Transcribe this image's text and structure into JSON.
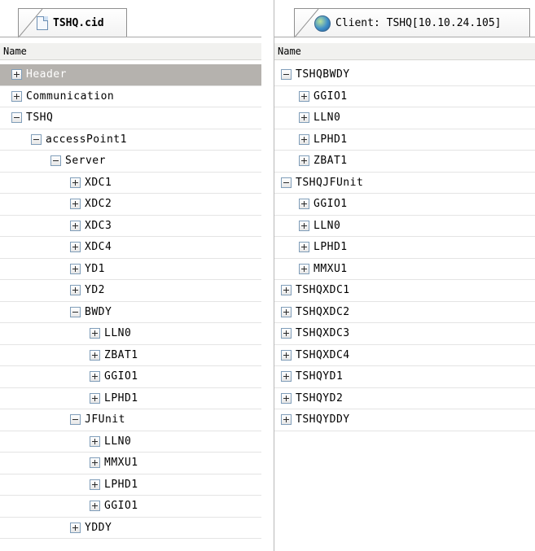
{
  "left_panel": {
    "tab_title": "TSHQ.cid",
    "column_header": "Name",
    "rows": [
      {
        "label": "Header",
        "expander": "plus",
        "level": 0,
        "selected": true
      },
      {
        "label": "Communication",
        "expander": "plus",
        "level": 0
      },
      {
        "label": "TSHQ",
        "expander": "minus",
        "level": 0
      },
      {
        "label": "accessPoint1",
        "expander": "minus",
        "level": 1
      },
      {
        "label": "Server",
        "expander": "minus",
        "level": 2
      },
      {
        "label": "XDC1",
        "expander": "plus",
        "level": 3
      },
      {
        "label": "XDC2",
        "expander": "plus",
        "level": 3
      },
      {
        "label": "XDC3",
        "expander": "plus",
        "level": 3
      },
      {
        "label": "XDC4",
        "expander": "plus",
        "level": 3
      },
      {
        "label": "YD1",
        "expander": "plus",
        "level": 3
      },
      {
        "label": "YD2",
        "expander": "plus",
        "level": 3
      },
      {
        "label": "BWDY",
        "expander": "minus",
        "level": 3
      },
      {
        "label": "LLN0",
        "expander": "plus",
        "level": 4
      },
      {
        "label": "ZBAT1",
        "expander": "plus",
        "level": 4
      },
      {
        "label": "GGIO1",
        "expander": "plus",
        "level": 4
      },
      {
        "label": "LPHD1",
        "expander": "plus",
        "level": 4
      },
      {
        "label": "JFUnit",
        "expander": "minus",
        "level": 3
      },
      {
        "label": "LLN0",
        "expander": "plus",
        "level": 4
      },
      {
        "label": "MMXU1",
        "expander": "plus",
        "level": 4
      },
      {
        "label": "LPHD1",
        "expander": "plus",
        "level": 4
      },
      {
        "label": "GGIO1",
        "expander": "plus",
        "level": 4
      },
      {
        "label": "YDDY",
        "expander": "plus",
        "level": 3
      }
    ]
  },
  "right_panel": {
    "tab_title": "Client: TSHQ[10.10.24.105]",
    "column_header": "Name",
    "rows": [
      {
        "label": "TSHQBWDY",
        "expander": "minus",
        "level": 0
      },
      {
        "label": "GGIO1",
        "expander": "plus",
        "level": 1
      },
      {
        "label": "LLN0",
        "expander": "plus",
        "level": 1
      },
      {
        "label": "LPHD1",
        "expander": "plus",
        "level": 1
      },
      {
        "label": "ZBAT1",
        "expander": "plus",
        "level": 1
      },
      {
        "label": "TSHQJFUnit",
        "expander": "minus",
        "level": 0
      },
      {
        "label": "GGIO1",
        "expander": "plus",
        "level": 1
      },
      {
        "label": "LLN0",
        "expander": "plus",
        "level": 1
      },
      {
        "label": "LPHD1",
        "expander": "plus",
        "level": 1
      },
      {
        "label": "MMXU1",
        "expander": "plus",
        "level": 1
      },
      {
        "label": "TSHQXDC1",
        "expander": "plus",
        "level": 0
      },
      {
        "label": "TSHQXDC2",
        "expander": "plus",
        "level": 0
      },
      {
        "label": "TSHQXDC3",
        "expander": "plus",
        "level": 0
      },
      {
        "label": "TSHQXDC4",
        "expander": "plus",
        "level": 0
      },
      {
        "label": "TSHQYD1",
        "expander": "plus",
        "level": 0
      },
      {
        "label": "TSHQYD2",
        "expander": "plus",
        "level": 0
      },
      {
        "label": "TSHQYDDY",
        "expander": "plus",
        "level": 0
      }
    ]
  }
}
